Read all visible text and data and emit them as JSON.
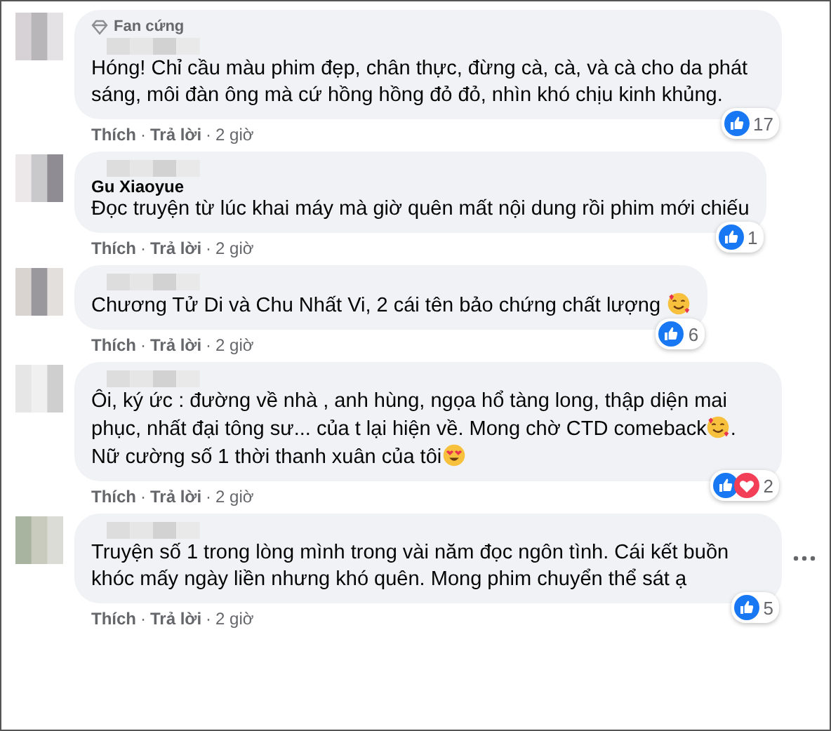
{
  "comments": [
    {
      "badge": "Fan cứng",
      "body": [
        {
          "kind": "text",
          "text": "Hóng! Chỉ cầu màu phim đẹp, chân thực, đừng cà, cà, và cà cho da phát sáng, môi đàn ông mà cứ hồng hồng đỏ đỏ, nhìn khó chịu kinh khủng."
        }
      ],
      "reactions": [
        {
          "kind": "like"
        }
      ],
      "count": "17",
      "meta": [
        {
          "kind": "link",
          "text": "Thích"
        },
        {
          "kind": "dot",
          "text": "·"
        },
        {
          "kind": "link",
          "text": "Trả lời"
        },
        {
          "kind": "dot",
          "text": "·"
        },
        {
          "kind": "time",
          "text": "2 giờ"
        }
      ]
    },
    {
      "author": "Gu Xiaoyue",
      "body": [
        {
          "kind": "text",
          "text": "Đọc truyện từ lúc khai máy mà giờ quên mất nội dung rồi phim mới chiếu"
        }
      ],
      "reactions": [
        {
          "kind": "like"
        }
      ],
      "count": "1",
      "meta": [
        {
          "kind": "link",
          "text": "Thích"
        },
        {
          "kind": "dot",
          "text": "·"
        },
        {
          "kind": "link",
          "text": "Trả lời"
        },
        {
          "kind": "dot",
          "text": "·"
        },
        {
          "kind": "time",
          "text": "2 giờ"
        }
      ]
    },
    {
      "body": [
        {
          "kind": "text",
          "text": "Chương Tử Di và Chu Nhất Vi, 2 cái tên bảo chứng chất lượng "
        },
        {
          "kind": "hearts"
        }
      ],
      "reactions": [
        {
          "kind": "like"
        }
      ],
      "count": "6",
      "meta": [
        {
          "kind": "link",
          "text": "Thích"
        },
        {
          "kind": "dot",
          "text": "·"
        },
        {
          "kind": "link",
          "text": "Trả lời"
        },
        {
          "kind": "dot",
          "text": "·"
        },
        {
          "kind": "time",
          "text": "2 giờ"
        }
      ]
    },
    {
      "body": [
        {
          "kind": "text",
          "text": "Ôi, ký ức : đường về nhà , anh hùng, ngọa hổ tàng long, thập diện mai phục, nhất đại tông sư... của t lại hiện về. Mong chờ CTD comeback"
        },
        {
          "kind": "hearts"
        },
        {
          "kind": "text",
          "text": ". Nữ cường số 1 thời thanh xuân của tôi"
        },
        {
          "kind": "hearteyes"
        }
      ],
      "reactions": [
        {
          "kind": "like"
        },
        {
          "kind": "love"
        }
      ],
      "count": "2",
      "meta": [
        {
          "kind": "link",
          "text": "Thích"
        },
        {
          "kind": "dot",
          "text": "·"
        },
        {
          "kind": "link",
          "text": "Trả lời"
        },
        {
          "kind": "dot",
          "text": "·"
        },
        {
          "kind": "time",
          "text": "2 giờ"
        }
      ]
    },
    {
      "body": [
        {
          "kind": "text",
          "text": "Truyện số 1 trong lòng mình trong vài năm đọc ngôn tình. Cái kết buồn khóc mấy ngày liền nhưng khó quên. Mong phim chuyển thể sát ạ"
        }
      ],
      "reactions": [
        {
          "kind": "like"
        }
      ],
      "count": "5",
      "more": true,
      "meta": [
        {
          "kind": "link",
          "text": "Thích"
        },
        {
          "kind": "dot",
          "text": "·"
        },
        {
          "kind": "link",
          "text": "Trả lời"
        },
        {
          "kind": "dot",
          "text": "·"
        },
        {
          "kind": "time",
          "text": "2 giờ"
        }
      ]
    }
  ]
}
